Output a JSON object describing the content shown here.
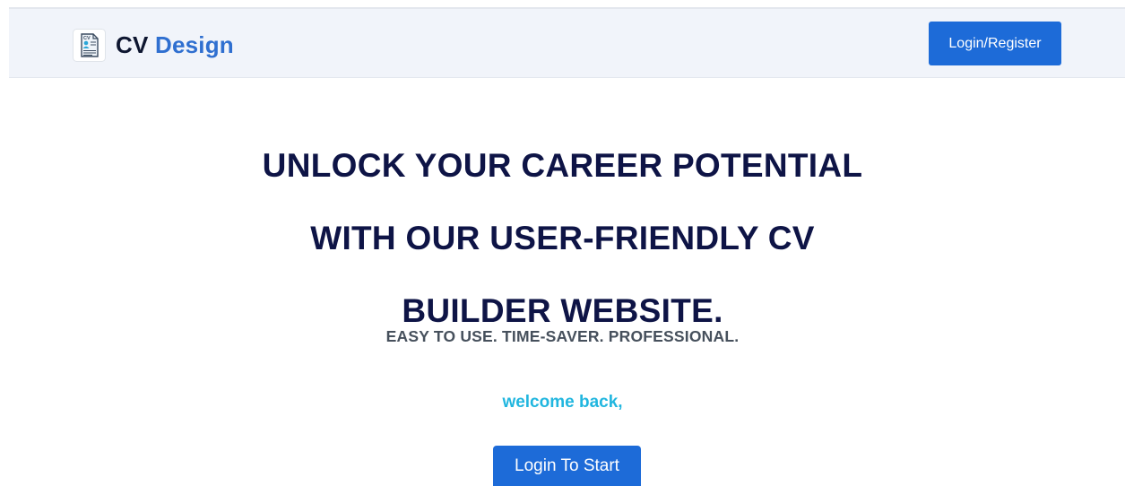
{
  "brand": {
    "logo_icon": "cv-document-icon",
    "name_part1": "CV",
    "name_part2": "Design",
    "accent_color": "#2f6fd0"
  },
  "header": {
    "login_register_label": "Login/Register",
    "button_color": "#1d6bd8"
  },
  "hero": {
    "headline_lines": [
      "UNLOCK YOUR CAREER POTENTIAL",
      "WITH OUR USER-FRIENDLY CV",
      "BUILDER WEBSITE."
    ],
    "tagline": "EASY TO USE. TIME-SAVER. PROFESSIONAL.",
    "welcome_text": "welcome back,",
    "welcome_color": "#21b6df",
    "start_button_label": "Login To Start"
  }
}
